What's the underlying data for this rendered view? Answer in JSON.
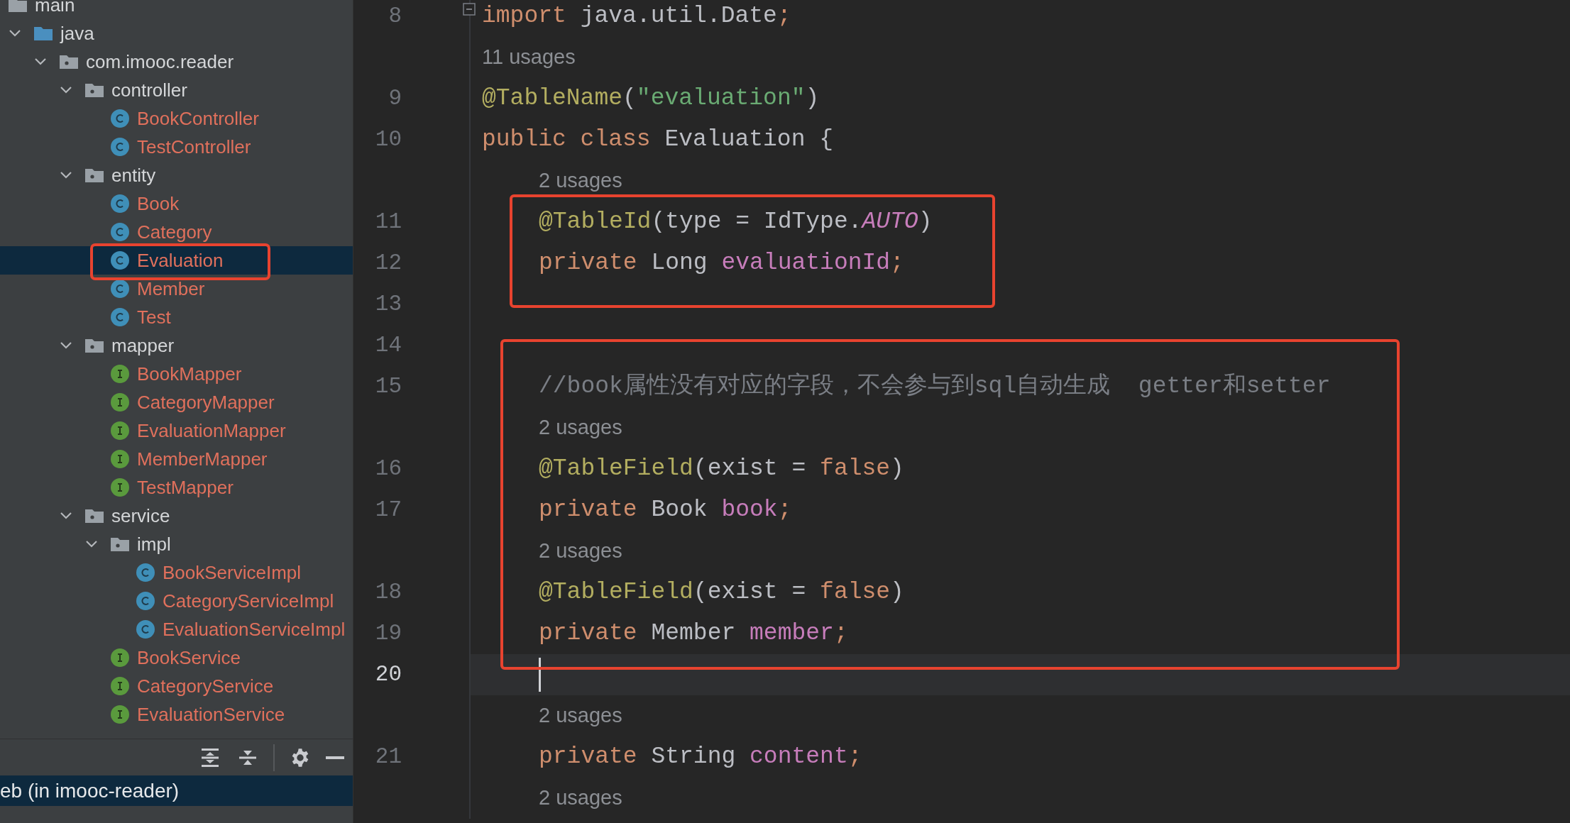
{
  "project_tree": {
    "items": [
      {
        "label": "main",
        "kind": "folder",
        "children": [
          {
            "label": "java",
            "kind": "source_folder",
            "expanded": true,
            "children": [
              {
                "label": "com.imooc.reader",
                "kind": "package",
                "expanded": true,
                "children": [
                  {
                    "label": "controller",
                    "kind": "package",
                    "expanded": true,
                    "children": [
                      {
                        "label": "BookController",
                        "kind": "class",
                        "selected": false,
                        "boxed": false
                      },
                      {
                        "label": "TestController",
                        "kind": "class",
                        "selected": false,
                        "boxed": false
                      }
                    ]
                  },
                  {
                    "label": "entity",
                    "kind": "package",
                    "expanded": true,
                    "children": [
                      {
                        "label": "Book",
                        "kind": "class",
                        "selected": false,
                        "boxed": false
                      },
                      {
                        "label": "Category",
                        "kind": "class",
                        "selected": false,
                        "boxed": false
                      },
                      {
                        "label": "Evaluation",
                        "kind": "class",
                        "selected": true,
                        "boxed": true
                      },
                      {
                        "label": "Member",
                        "kind": "class",
                        "selected": false,
                        "boxed": false
                      },
                      {
                        "label": "Test",
                        "kind": "class",
                        "selected": false,
                        "boxed": false
                      }
                    ]
                  },
                  {
                    "label": "mapper",
                    "kind": "package",
                    "expanded": true,
                    "children": [
                      {
                        "label": "BookMapper",
                        "kind": "interface",
                        "selected": false,
                        "boxed": false
                      },
                      {
                        "label": "CategoryMapper",
                        "kind": "interface",
                        "selected": false,
                        "boxed": false
                      },
                      {
                        "label": "EvaluationMapper",
                        "kind": "interface",
                        "selected": false,
                        "boxed": false
                      },
                      {
                        "label": "MemberMapper",
                        "kind": "interface",
                        "selected": false,
                        "boxed": false
                      },
                      {
                        "label": "TestMapper",
                        "kind": "interface",
                        "selected": false,
                        "boxed": false
                      }
                    ]
                  },
                  {
                    "label": "service",
                    "kind": "package",
                    "expanded": true,
                    "children": [
                      {
                        "label": "impl",
                        "kind": "package",
                        "expanded": true,
                        "children": [
                          {
                            "label": "BookServiceImpl",
                            "kind": "class",
                            "selected": false,
                            "boxed": false
                          },
                          {
                            "label": "CategoryServiceImpl",
                            "kind": "class",
                            "selected": false,
                            "boxed": false
                          },
                          {
                            "label": "EvaluationServiceImpl",
                            "kind": "class",
                            "selected": false,
                            "boxed": false
                          }
                        ]
                      },
                      {
                        "label": "BookService",
                        "kind": "interface",
                        "selected": false,
                        "boxed": false
                      },
                      {
                        "label": "CategoryService",
                        "kind": "interface",
                        "selected": false,
                        "boxed": false
                      },
                      {
                        "label": "EvaluationService",
                        "kind": "interface",
                        "selected": false,
                        "boxed": false
                      }
                    ]
                  }
                ]
              }
            ]
          }
        ]
      }
    ]
  },
  "status_row": {
    "text": "eb (in imooc-reader)",
    "selected": true
  },
  "editor": {
    "lines": [
      {
        "kind": "code",
        "number": "8",
        "current": false,
        "foldable": true,
        "tokens": [
          {
            "text": "import",
            "kind": "keyword"
          },
          {
            "text": " java.util.Date",
            "kind": "plain"
          },
          {
            "text": ";",
            "kind": "keyword"
          }
        ]
      },
      {
        "kind": "usages",
        "text": "11 usages",
        "indent": false
      },
      {
        "kind": "code",
        "number": "9",
        "current": false,
        "foldable": false,
        "tokens": [
          {
            "text": "@TableName",
            "kind": "annotation"
          },
          {
            "text": "(",
            "kind": "plain"
          },
          {
            "text": "\"evaluation\"",
            "kind": "string"
          },
          {
            "text": ")",
            "kind": "plain"
          }
        ]
      },
      {
        "kind": "code",
        "number": "10",
        "current": false,
        "foldable": false,
        "tokens": [
          {
            "text": "public class",
            "kind": "keyword"
          },
          {
            "text": " Evaluation {",
            "kind": "plain"
          }
        ]
      },
      {
        "kind": "usages",
        "text": "2 usages",
        "indent": true
      },
      {
        "kind": "code",
        "number": "11",
        "current": false,
        "foldable": false,
        "indent": true,
        "tokens": [
          {
            "text": "@TableId",
            "kind": "annotation"
          },
          {
            "text": "(type = IdType.",
            "kind": "plain"
          },
          {
            "text": "AUTO",
            "kind": "constant"
          },
          {
            "text": ")",
            "kind": "plain"
          }
        ]
      },
      {
        "kind": "code",
        "number": "12",
        "current": false,
        "foldable": false,
        "indent": true,
        "tokens": [
          {
            "text": "private",
            "kind": "keyword"
          },
          {
            "text": " Long ",
            "kind": "plain"
          },
          {
            "text": "evaluationId",
            "kind": "field"
          },
          {
            "text": ";",
            "kind": "keyword"
          }
        ]
      },
      {
        "kind": "code",
        "number": "13",
        "current": false,
        "foldable": false
      },
      {
        "kind": "code",
        "number": "14",
        "current": false,
        "foldable": false
      },
      {
        "kind": "code",
        "number": "15",
        "current": false,
        "foldable": false,
        "indent": true,
        "tokens": [
          {
            "text": "//book属性没有对应的字段，不会参与到sql自动生成  getter和setter",
            "kind": "comment"
          }
        ]
      },
      {
        "kind": "usages",
        "text": "2 usages",
        "indent": true
      },
      {
        "kind": "code",
        "number": "16",
        "current": false,
        "foldable": false,
        "indent": true,
        "tokens": [
          {
            "text": "@TableField",
            "kind": "annotation"
          },
          {
            "text": "(exist = ",
            "kind": "plain"
          },
          {
            "text": "false",
            "kind": "keyword"
          },
          {
            "text": ")",
            "kind": "plain"
          }
        ]
      },
      {
        "kind": "code",
        "number": "17",
        "current": false,
        "foldable": false,
        "indent": true,
        "tokens": [
          {
            "text": "private",
            "kind": "keyword"
          },
          {
            "text": " Book ",
            "kind": "plain"
          },
          {
            "text": "book",
            "kind": "field"
          },
          {
            "text": ";",
            "kind": "keyword"
          }
        ]
      },
      {
        "kind": "usages",
        "text": "2 usages",
        "indent": true
      },
      {
        "kind": "code",
        "number": "18",
        "current": false,
        "foldable": false,
        "indent": true,
        "tokens": [
          {
            "text": "@TableField",
            "kind": "annotation"
          },
          {
            "text": "(exist = ",
            "kind": "plain"
          },
          {
            "text": "false",
            "kind": "keyword"
          },
          {
            "text": ")",
            "kind": "plain"
          }
        ]
      },
      {
        "kind": "code",
        "number": "19",
        "current": false,
        "foldable": false,
        "indent": true,
        "tokens": [
          {
            "text": "private",
            "kind": "keyword"
          },
          {
            "text": " Member ",
            "kind": "plain"
          },
          {
            "text": "member",
            "kind": "field"
          },
          {
            "text": ";",
            "kind": "keyword"
          }
        ]
      },
      {
        "kind": "code",
        "number": "20",
        "current": true,
        "foldable": false
      },
      {
        "kind": "usages",
        "text": "2 usages",
        "indent": true
      },
      {
        "kind": "code",
        "number": "21",
        "current": false,
        "foldable": false,
        "indent": true,
        "tokens": [
          {
            "text": "private",
            "kind": "keyword"
          },
          {
            "text": " String ",
            "kind": "plain"
          },
          {
            "text": "content",
            "kind": "field"
          },
          {
            "text": ";",
            "kind": "keyword"
          }
        ]
      },
      {
        "kind": "usages",
        "text": "2 usages",
        "indent": true
      }
    ]
  }
}
